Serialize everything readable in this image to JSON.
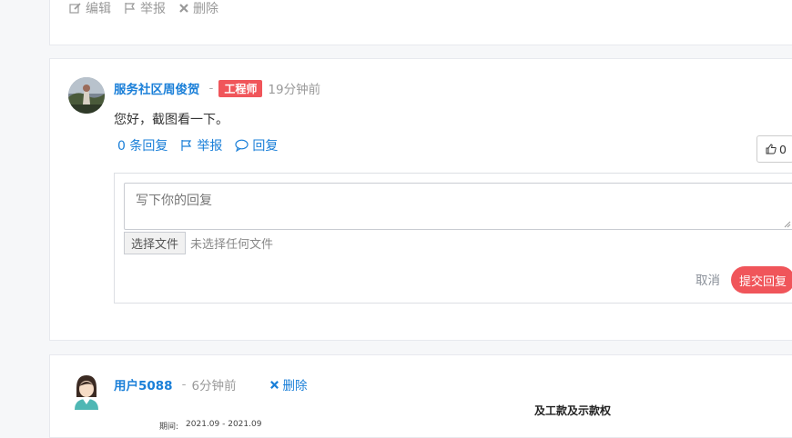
{
  "top_actions": {
    "edit": "编辑",
    "report": "举报",
    "delete": "删除"
  },
  "comment": {
    "username": "服务社区周俊贺",
    "badge": "工程师",
    "time": "19分钟前",
    "text": "您好，截图看一下。",
    "replies_link": "0 条回复",
    "report_link": "举报",
    "reply_link": "回复",
    "likes": "0"
  },
  "reply_form": {
    "placeholder": "写下你的回复",
    "choose_file": "选择文件",
    "no_file": "未选择任何文件",
    "cancel": "取消",
    "submit": "提交回复"
  },
  "next_comment": {
    "username": "用户5088",
    "time": "6分钟前",
    "delete": "删除",
    "image_text": "及工款及示款权",
    "image_label": "期间:",
    "image_date": "2021.09 - 2021.09"
  },
  "colors": {
    "link": "#1a7fd8",
    "badge": "#f0555a",
    "submit": "#f0555a"
  }
}
